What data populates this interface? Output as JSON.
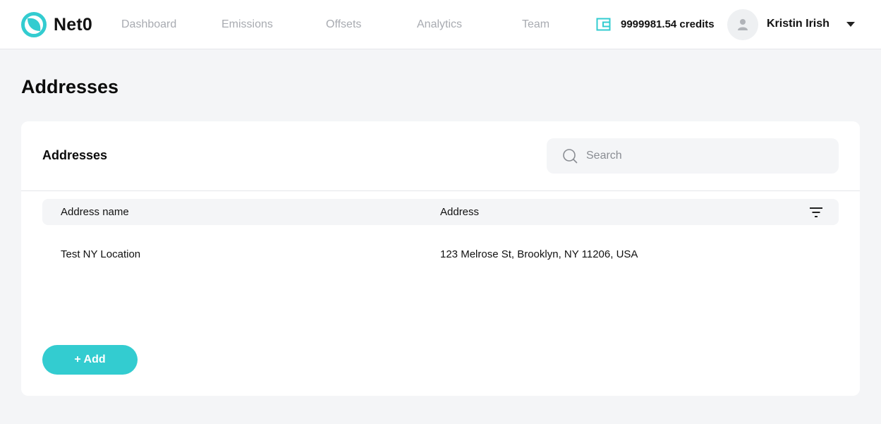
{
  "brand": {
    "name": "Net0"
  },
  "nav": [
    {
      "label": "Dashboard"
    },
    {
      "label": "Emissions"
    },
    {
      "label": "Offsets"
    },
    {
      "label": "Analytics"
    },
    {
      "label": "Team"
    }
  ],
  "credits": {
    "text": "9999981.54 credits"
  },
  "user": {
    "name": "Kristin Irish"
  },
  "page": {
    "title": "Addresses"
  },
  "card": {
    "title": "Addresses",
    "search_placeholder": "Search",
    "search_value": "",
    "columns": [
      "Address name",
      "Address"
    ],
    "rows": [
      {
        "name": "Test NY Location",
        "address": "123 Melrose St, Brooklyn, NY 11206, USA"
      }
    ],
    "add_label": "+ Add"
  },
  "colors": {
    "accent": "#33ccd0",
    "nav_inactive": "#a8abb1",
    "background": "#f4f5f7"
  },
  "icons": [
    "net0-logo-icon",
    "wallet-icon",
    "user-avatar-icon",
    "chevron-down-icon",
    "search-icon",
    "filter-icon"
  ]
}
